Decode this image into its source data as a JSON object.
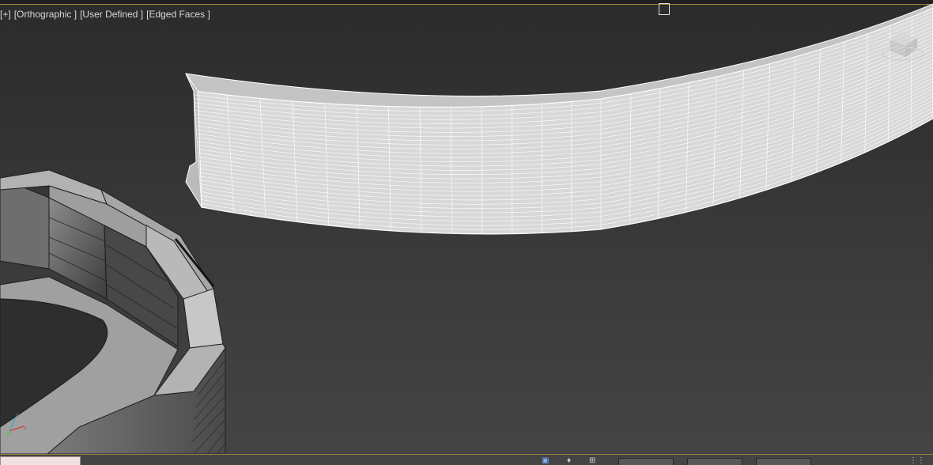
{
  "viewport": {
    "label_parts": [
      "[+]",
      "[Orthographic ]",
      "[User Defined ]",
      "[Edged Faces ]"
    ]
  },
  "colors": {
    "background_top": "#2b2b2b",
    "background_bottom": "#454545",
    "mesh_face": "#a9a9a9",
    "wireframe": "#ffffff",
    "accent_border": "#a0823c"
  },
  "icons": {
    "axis_gizmo": "axis-tripod-icon",
    "viewcube": "viewcube-icon",
    "status_bar": [
      "selection-lock-icon",
      "key-icon",
      "grid-icon"
    ]
  }
}
